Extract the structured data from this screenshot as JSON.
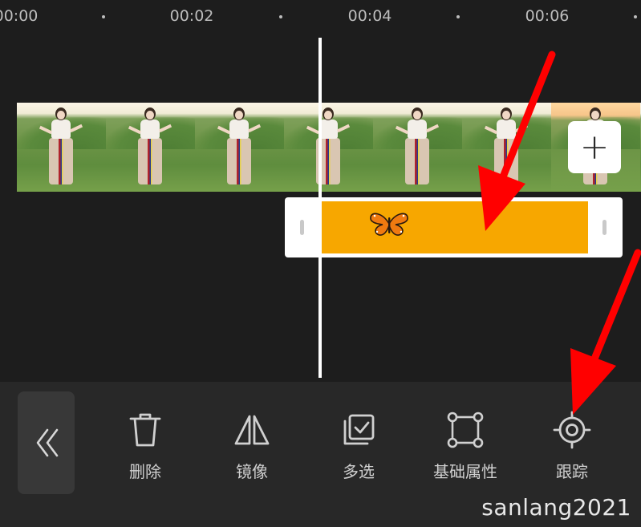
{
  "ruler": {
    "labels": [
      "00:00",
      "00:02",
      "00:04",
      "00:06"
    ]
  },
  "timeline": {
    "add_button_label": "+",
    "sticker": {
      "emoji": "🦋",
      "fill_color": "#f7a700"
    },
    "playhead_color": "#ffffff"
  },
  "toolbar": {
    "back_icon": "double-chevron-left-icon",
    "items": [
      {
        "label": "删除",
        "icon": "trash-icon"
      },
      {
        "label": "镜像",
        "icon": "mirror-icon"
      },
      {
        "label": "多选",
        "icon": "multi-select-icon"
      },
      {
        "label": "基础属性",
        "icon": "basic-properties-icon"
      },
      {
        "label": "跟踪",
        "icon": "tracking-icon"
      }
    ]
  },
  "watermark": "sanlang2021",
  "annotations": {
    "arrow_color": "#ff0000"
  }
}
